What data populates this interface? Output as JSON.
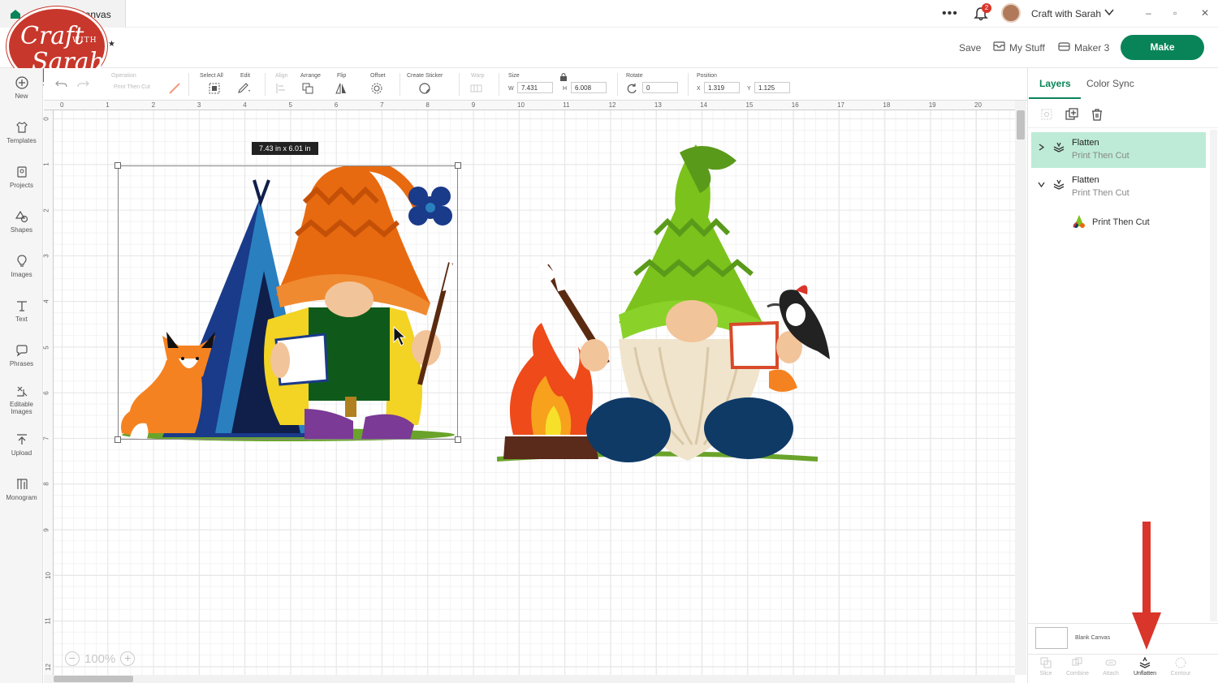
{
  "tab": {
    "title": "Canvas"
  },
  "topbar": {
    "notifications_count": "2",
    "user_name": "Craft with Sarah",
    "window_controls": [
      "–",
      "▫",
      "✕"
    ]
  },
  "logo": {
    "line1": "Craft",
    "line2": "WITH",
    "line3": "Sarah"
  },
  "header": {
    "save_label": "Save",
    "mystuff_label": "My Stuff",
    "machine_label": "Maker 3",
    "make_label": "Make"
  },
  "sidebar": {
    "items": [
      {
        "label": "New",
        "icon": "plus-circle-icon"
      },
      {
        "label": "Templates",
        "icon": "shirt-icon"
      },
      {
        "label": "Projects",
        "icon": "projects-icon"
      },
      {
        "label": "Shapes",
        "icon": "shapes-icon"
      },
      {
        "label": "Images",
        "icon": "lightbulb-icon"
      },
      {
        "label": "Text",
        "icon": "text-icon"
      },
      {
        "label": "Phrases",
        "icon": "speech-bubble-icon"
      },
      {
        "label": "Editable",
        "label2": "Images",
        "icon": "editable-images-icon"
      },
      {
        "label": "Upload",
        "icon": "upload-icon"
      },
      {
        "label": "Monogram",
        "icon": "monogram-icon"
      }
    ]
  },
  "toolbar": {
    "operation_label": "Operation",
    "operation_value": "Print Then Cut",
    "select_all_label": "Select All",
    "edit_label": "Edit",
    "align_label": "Align",
    "arrange_label": "Arrange",
    "flip_label": "Flip",
    "offset_label": "Offset",
    "create_sticker_label": "Create Sticker",
    "warp_label": "Warp",
    "size_label": "Size",
    "w_label": "W",
    "w_value": "7.431",
    "h_label": "H",
    "h_value": "6.008",
    "rotate_label": "Rotate",
    "rotate_value": "0",
    "position_label": "Position",
    "x_label": "X",
    "x_value": "1.319",
    "y_label": "Y",
    "y_value": "1.125"
  },
  "rulers": {
    "top": [
      "0",
      "1",
      "2",
      "3",
      "4",
      "5",
      "6",
      "7",
      "8",
      "9",
      "10",
      "11",
      "12",
      "13",
      "14",
      "15",
      "16",
      "17",
      "18",
      "19",
      "20"
    ],
    "left": [
      "0",
      "1",
      "2",
      "3",
      "4",
      "5",
      "6",
      "7",
      "8",
      "9",
      "10",
      "11",
      "12"
    ]
  },
  "canvas": {
    "size_tooltip": "7.43  in x 6.01  in",
    "zoom": "100%"
  },
  "panel": {
    "tabs": [
      "Layers",
      "Color Sync"
    ],
    "layers": [
      {
        "name": "Flatten",
        "sub": "Print Then Cut",
        "expanded": false,
        "selected": true
      },
      {
        "name": "Flatten",
        "sub": "Print Then Cut",
        "expanded": true,
        "selected": false
      }
    ],
    "sublayer": "Print Then Cut",
    "blank_canvas": "Blank Canvas",
    "bottom_actions": [
      {
        "label": "Slice",
        "enabled": false
      },
      {
        "label": "Combine",
        "enabled": false
      },
      {
        "label": "Attach",
        "enabled": false
      },
      {
        "label": "Unflatten",
        "enabled": true
      },
      {
        "label": "Contour",
        "enabled": false
      }
    ]
  },
  "colors": {
    "brand_green": "#098458",
    "selected_layer": "#bdebd7",
    "arrow_red": "#d9352a",
    "logo_red": "#c8372b"
  }
}
